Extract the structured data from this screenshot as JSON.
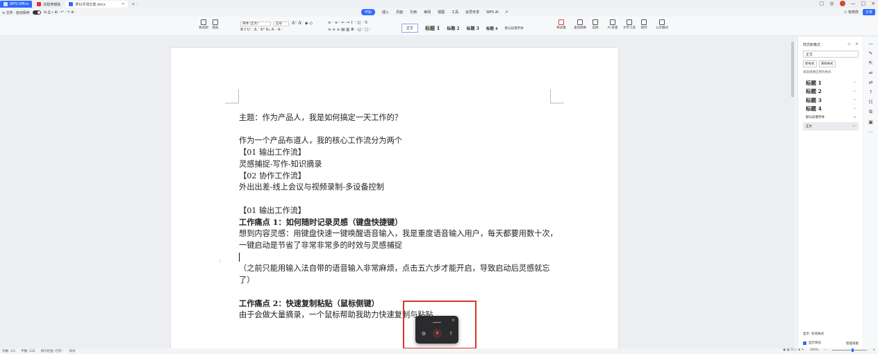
{
  "titlebar": {
    "tabs": [
      {
        "label": "WPS Office",
        "color": "#2f6bff"
      },
      {
        "label": "找稻壳模板",
        "color": "#d9342b"
      },
      {
        "label": "梦幻评测文案.docx",
        "color": "#2f6bff"
      }
    ],
    "tab_close": "×",
    "new_tab": "+ ·",
    "window_controls": [
      "—",
      "□",
      "×"
    ]
  },
  "menubar": {
    "left": [
      "≡ 文件",
      "自动保存"
    ],
    "quick_icons": "⊟ ⎙ ⌕ ⊞ · ↶ · ↷ ⊛ ·",
    "tabs": [
      "开始",
      "插入",
      "页面",
      "引用",
      "审阅",
      "视图",
      "工具",
      "会员专享",
      "WPS AI"
    ],
    "search_icon": "search-icon",
    "right": [
      "⚇ 有修改",
      "分享"
    ]
  },
  "ribbon": {
    "format_painter": "格式刷",
    "paste": "粘贴",
    "font_name": "宋体 (正文)",
    "font_size": "五号",
    "format_row1": "A⁺ A⁻ ◈ ◇",
    "format_row2": "B I U · A · X² X₂ A · A ·",
    "para_row1": "≡ · ≡ · ⇤ ⇥ ↕ · ◫ · ⇅",
    "para_row2": "≡ ≡ ≡ ▤ ▥ ≣ · ◱ · □ ·",
    "styles": [
      "正文",
      "标题 1",
      "标题 2",
      "标题 3",
      "标题 4",
      "默认段落字体"
    ],
    "right_tools": [
      "样式集",
      "查找替换",
      "选择",
      "AI 排版",
      "文字工具",
      "排列",
      "公文模式"
    ]
  },
  "document": {
    "lines": [
      {
        "text": "主题：作为产品人，我是如何搞定一天工作的？",
        "bold": false
      },
      {
        "text": "",
        "bold": false
      },
      {
        "text": "作为一个产品布道人，我的核心工作流分为两个",
        "bold": false
      },
      {
        "text": "【01 输出工作流】",
        "bold": false
      },
      {
        "text": "灵感捕捉-写作-知识摘录",
        "bold": false
      },
      {
        "text": "【02 协作工作流】",
        "bold": false
      },
      {
        "text": "外出出差-线上会议与视频录制-多设备控制",
        "bold": false
      },
      {
        "text": "",
        "bold": false
      },
      {
        "text": "【01 输出工作流】",
        "bold": false
      },
      {
        "text": "工作痛点 1：如何随时记录灵感（键盘快捷键）",
        "bold": true
      },
      {
        "text": "想到内容灵感：用键盘快速一键唤醒语音输入，我是重度语音输入用户，每天都要用数十次，",
        "bold": false
      },
      {
        "text": "一键启动是节省了非常非常多的时效与灵感捕捉",
        "bold": false
      },
      {
        "text": "",
        "bold": false,
        "cursor": true
      },
      {
        "text": "（之前只能用输入法自带的语音输入非常麻烦，点击五六步才能开启，导致启动后灵感就忘",
        "bold": false
      },
      {
        "text": "了）",
        "bold": false
      },
      {
        "text": "",
        "bold": false
      },
      {
        "text": "工作痛点 2：快速复制粘贴（鼠标侧键）",
        "bold": true
      },
      {
        "text": "由于会做大量摘录，一个鼠标帮助我助力快速复制与粘贴",
        "bold": false
      }
    ],
    "margin_mark": "⁝"
  },
  "voice_widget": {
    "close": "×",
    "settings_icon": "gear-icon",
    "mic_icon": "microphone-icon",
    "help_icon": "help-icon",
    "highlight_color": "#d9342b"
  },
  "panel": {
    "title": "样式和格式 ·",
    "current_style": "正文",
    "new_style": "新样式",
    "clear_format": "清除格式",
    "subtitle": "请选择要应用的格式",
    "styles": [
      {
        "label": "标题 1",
        "mark": "↵",
        "small": false
      },
      {
        "label": "标题 2",
        "mark": "↵",
        "small": false
      },
      {
        "label": "标题 3",
        "mark": "↵",
        "small": false
      },
      {
        "label": "标题 4",
        "mark": "↵",
        "small": false
      },
      {
        "label": "默认段落字体",
        "mark": "a",
        "small": true
      },
      {
        "label": "正文",
        "mark": "↵",
        "small": true
      }
    ],
    "show_label": "显示: 有效样式",
    "preview_label": "显示预览",
    "smart_label": "智能排版"
  },
  "statusbar": {
    "left": [
      "页数: 1/1",
      "字数: 532",
      "拼写检查: 打开 ·",
      "校对"
    ],
    "zoom": "100%",
    "zoom_controls": [
      "−",
      "+"
    ]
  }
}
